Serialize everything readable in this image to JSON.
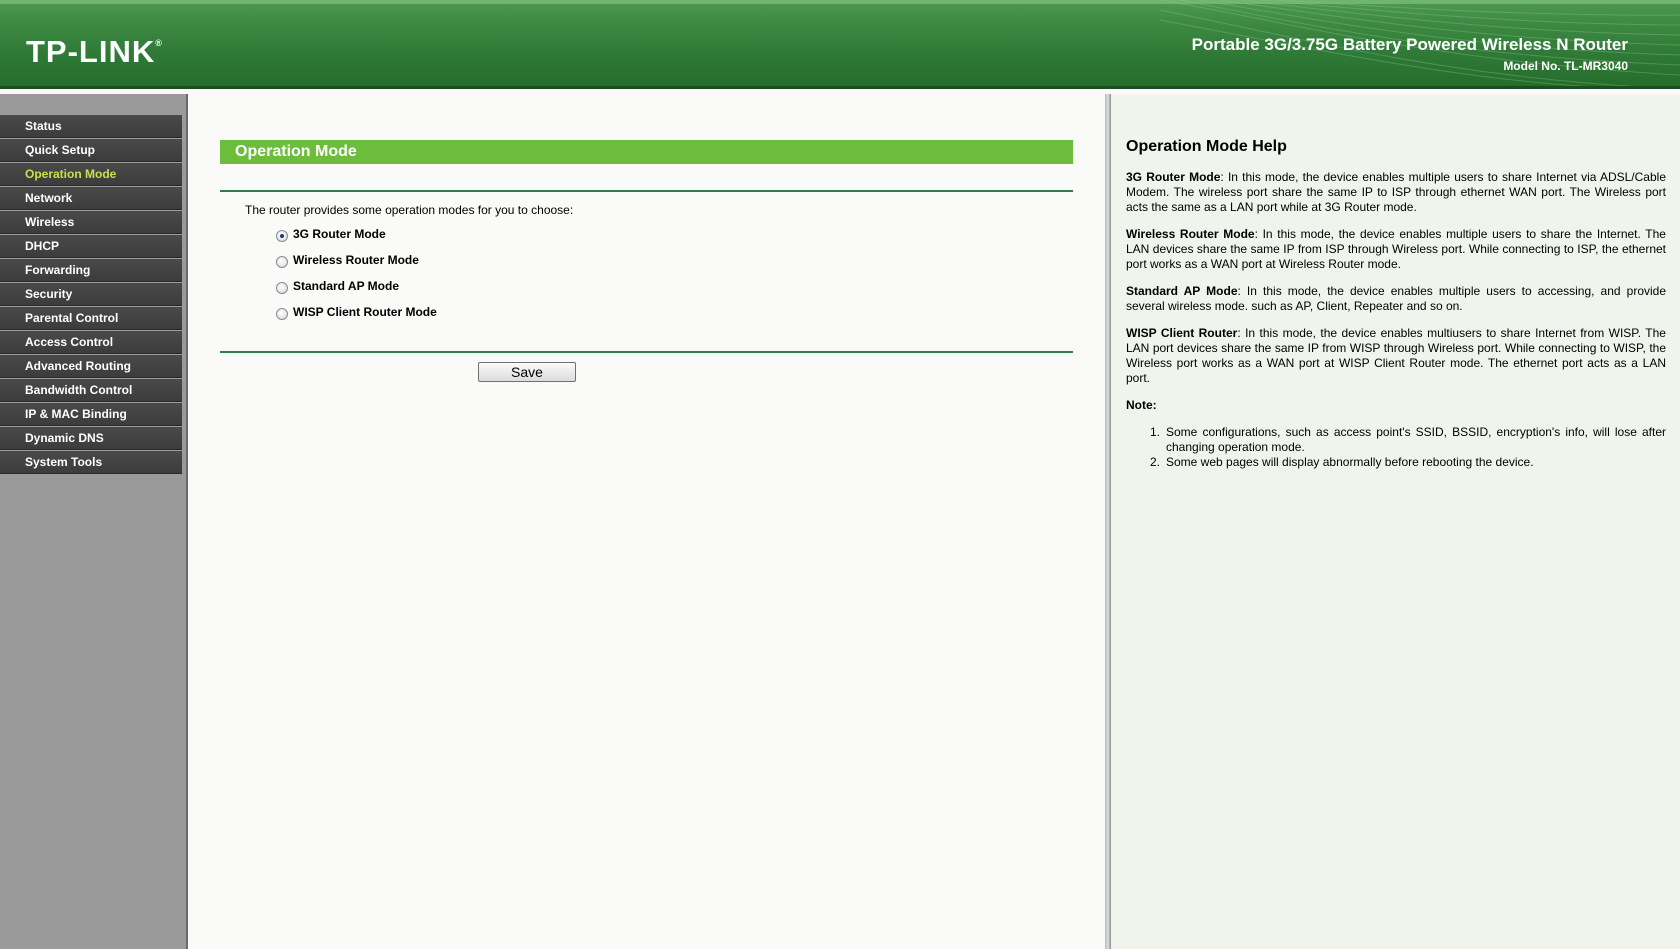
{
  "header": {
    "logo": "TP-LINK",
    "logo_mark": "®",
    "product_title": "Portable 3G/3.75G Battery Powered Wireless N Router",
    "model_no": "Model No. TL-MR3040",
    "colors": {
      "header_green": "#2f7a36",
      "accent_green": "#6cbd3c"
    }
  },
  "sidebar": {
    "items": [
      {
        "label": "Status",
        "active": false
      },
      {
        "label": "Quick Setup",
        "active": false
      },
      {
        "label": "Operation Mode",
        "active": true
      },
      {
        "label": "Network",
        "active": false
      },
      {
        "label": "Wireless",
        "active": false
      },
      {
        "label": "DHCP",
        "active": false
      },
      {
        "label": "Forwarding",
        "active": false
      },
      {
        "label": "Security",
        "active": false
      },
      {
        "label": "Parental Control",
        "active": false
      },
      {
        "label": "Access Control",
        "active": false
      },
      {
        "label": "Advanced Routing",
        "active": false
      },
      {
        "label": "Bandwidth Control",
        "active": false
      },
      {
        "label": "IP & MAC Binding",
        "active": false
      },
      {
        "label": "Dynamic DNS",
        "active": false
      },
      {
        "label": "System Tools",
        "active": false
      }
    ],
    "active_color": "#c6e34a"
  },
  "main": {
    "section_title": "Operation Mode",
    "intro": "The router provides some operation modes for you to choose:",
    "modes": [
      {
        "label": "3G Router Mode",
        "checked": true
      },
      {
        "label": "Wireless Router Mode",
        "checked": false
      },
      {
        "label": "Standard AP Mode",
        "checked": false
      },
      {
        "label": "WISP Client Router Mode",
        "checked": false
      }
    ],
    "save_label": "Save"
  },
  "help": {
    "title": "Operation Mode Help",
    "paragraphs": [
      {
        "term": "3G Router Mode",
        "text": ": In this mode, the device enables multiple users to share Internet via ADSL/Cable Modem. The wireless port share the same IP to ISP through ethernet WAN port. The Wireless port acts the same as a LAN port while at 3G Router mode."
      },
      {
        "term": "Wireless Router Mode",
        "text": ": In this mode, the device enables multiple users to share the Internet. The LAN devices share the same IP from ISP through Wireless port. While connecting to ISP, the ethernet port works as a WAN port at Wireless Router mode."
      },
      {
        "term": "Standard AP Mode",
        "text": ": In this mode, the device enables multiple users to accessing, and provide several wireless mode. such as AP, Client, Repeater and so on."
      },
      {
        "term": "WISP Client Router",
        "text": ": In this mode, the device enables multiusers to share Internet from WISP. The LAN port devices share the same IP from WISP through Wireless port. While connecting to WISP, the Wireless port works as a WAN port at WISP Client Router mode. The ethernet port acts as a LAN port."
      }
    ],
    "note_label": "Note:",
    "notes": [
      "Some configurations, such as access point's SSID, BSSID, encryption's info, will lose after changing operation mode.",
      "Some web pages will display abnormally before rebooting the device."
    ]
  }
}
